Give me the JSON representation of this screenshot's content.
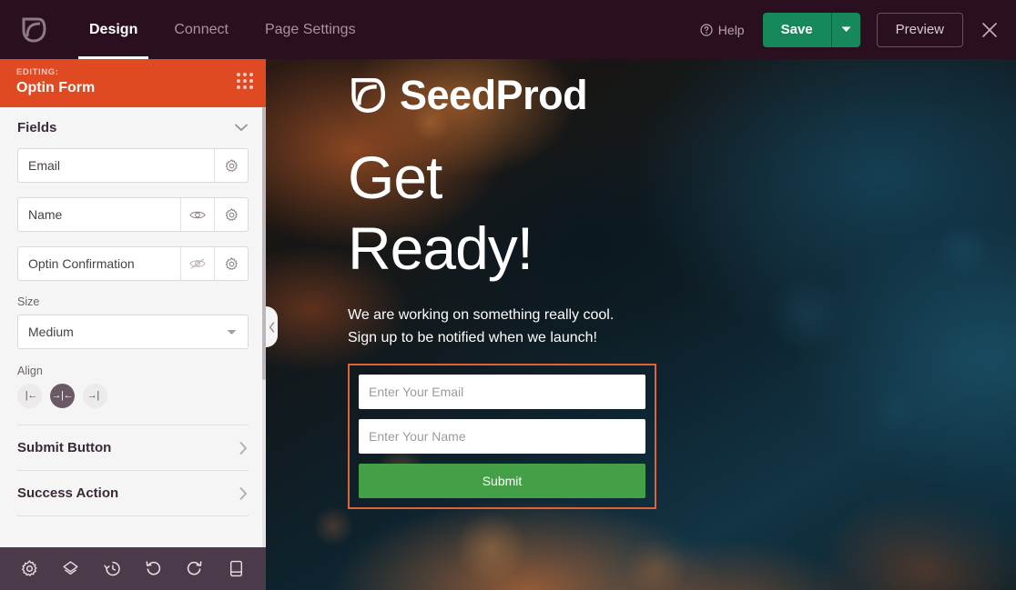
{
  "topbar": {
    "logo_icon": "seedprod-leaf-logo-icon",
    "tabs": [
      {
        "label": "Design",
        "active": true
      },
      {
        "label": "Connect",
        "active": false
      },
      {
        "label": "Page Settings",
        "active": false
      }
    ],
    "help_label": "Help",
    "help_icon": "question-circle-icon",
    "save_label": "Save",
    "save_caret_icon": "chevron-down-icon",
    "preview_label": "Preview",
    "close_icon": "close-x-icon",
    "colors": {
      "bar_bg": "#2a0f1e",
      "save_green": "#17875c",
      "active_tab_text": "#ffffff",
      "inactive_tab_text": "#a9929e"
    }
  },
  "sidebar": {
    "editing_eyebrow": "EDITING:",
    "editing_title": "Optin Form",
    "drag_handle_icon": "grid-dots-drag-handle-icon",
    "editing_bar_color": "#df4a22",
    "fields_section": {
      "title": "Fields",
      "chevron_icon": "chevron-down-icon",
      "rows": [
        {
          "name": "Email",
          "has_visibility_toggle": false,
          "visibility_icon": "",
          "settings_icon": "gear-icon"
        },
        {
          "name": "Name",
          "has_visibility_toggle": true,
          "visibility_icon": "eye-icon",
          "settings_icon": "gear-icon"
        },
        {
          "name": "Optin Confirmation",
          "has_visibility_toggle": true,
          "visibility_icon": "eye-slash-icon",
          "settings_icon": "gear-icon"
        }
      ]
    },
    "size_control": {
      "label": "Size",
      "value": "Medium",
      "caret_icon": "caret-down-icon"
    },
    "align_control": {
      "label": "Align",
      "options": [
        {
          "name": "left",
          "glyph": "|←",
          "icon": "align-left-icon",
          "active": false
        },
        {
          "name": "center",
          "glyph": "→|←",
          "icon": "align-center-icon",
          "active": true
        },
        {
          "name": "right",
          "glyph": "→|",
          "icon": "align-right-icon",
          "active": false
        }
      ]
    },
    "accordions": [
      {
        "label": "Submit Button",
        "chevron_icon": "chevron-right-icon"
      },
      {
        "label": "Success Action",
        "chevron_icon": "chevron-right-icon"
      }
    ],
    "collapse_tab_icon": "chevron-left-icon",
    "bottom_toolbar": [
      {
        "icon": "gear-settings-icon",
        "name": "global-settings"
      },
      {
        "icon": "layers-icon",
        "name": "layer-navigator"
      },
      {
        "icon": "revision-history-clock-icon",
        "name": "revision-history"
      },
      {
        "icon": "undo-arrow-icon",
        "name": "undo"
      },
      {
        "icon": "redo-arrow-icon",
        "name": "redo"
      },
      {
        "icon": "device-preview-icon",
        "name": "device-preview"
      }
    ]
  },
  "preview": {
    "logo_text": "SeedProd",
    "logo_icon": "seedprod-leaf-logo-icon",
    "headline_line1": "Get",
    "headline_line2": "Ready!",
    "subtext_line1": "We are working on something really cool.",
    "subtext_line2": "Sign up to be notified when we launch!",
    "form": {
      "selection_border_color": "#e06335",
      "email_placeholder": "Enter Your Email",
      "name_placeholder": "Enter Your Name",
      "submit_label": "Submit",
      "submit_color": "#44a047"
    }
  }
}
